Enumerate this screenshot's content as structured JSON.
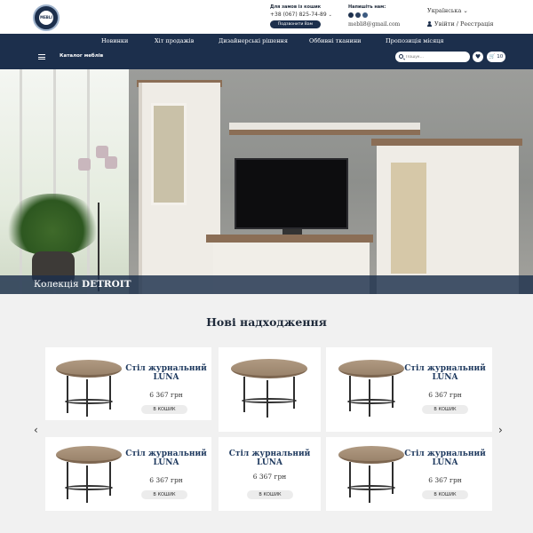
{
  "header": {
    "logo_alt": "mebli logo",
    "phone_label": "Для замов із кошик",
    "phone": "+38 (067) 825-74-89",
    "callback_label": "Подзвонити Вам",
    "write_label": "Напишіть нам:",
    "email": "mebli8@gmail.com",
    "language": "Українська",
    "login": "Увійти / Реєстрація"
  },
  "nav": {
    "items": [
      "Новинки",
      "Хіт продажів",
      "Дизайнерські рішення",
      "Оббивні тканини",
      "Пропозиція місяця"
    ],
    "catalog": "Каталог меблів",
    "search_placeholder": "Пошук...",
    "cart_count": "10"
  },
  "hero": {
    "caption_prefix": "Колекція",
    "caption_name": "DETROIT"
  },
  "new_arrivals": {
    "title": "Нові надходження",
    "prev_arrow": "‹",
    "next_arrow": "›",
    "products": [
      {
        "name_line1": "Стіл журнальний",
        "name_line2": "LUNA",
        "price": "6 367 грн",
        "button": "В КОШИК"
      },
      {
        "name_line1": "",
        "name_line2": "",
        "price": "",
        "button": ""
      },
      {
        "name_line1": "Стіл журнальний",
        "name_line2": "LUNA",
        "price": "6 367 грн",
        "button": "В КОШИК"
      },
      {
        "name_line1": "Стіл журнальний",
        "name_line2": "LUNA",
        "price": "6 367 грн",
        "button": "В КОШИК"
      },
      {
        "name_line1": "Стіл журнальний",
        "name_line2": "LUNA",
        "price": "6 367 грн",
        "button": "В КОШИК"
      },
      {
        "name_line1": "Стіл журнальний",
        "name_line2": "LUNA",
        "price": "6 367 грн",
        "button": "В КОШИК"
      }
    ]
  },
  "colors": {
    "navy": "#1c2f4c",
    "product_name": "#1f3a5f",
    "page_bg": "#f1f1f1"
  }
}
